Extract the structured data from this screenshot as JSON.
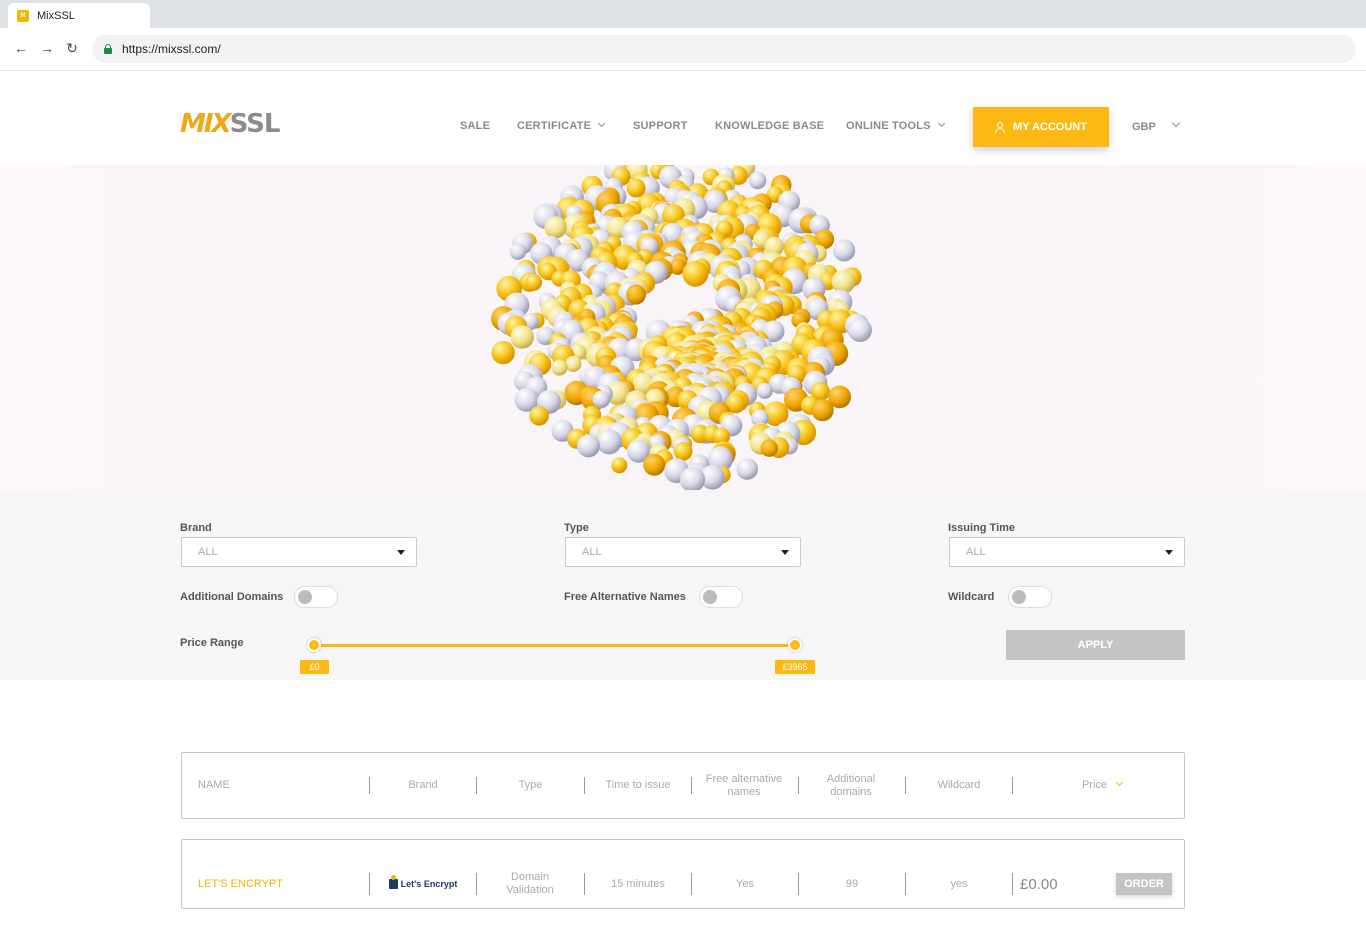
{
  "browser": {
    "tab_title": "MixSSL",
    "favicon_label": "M",
    "url": "https://mixssl.com/",
    "back": "←",
    "forward": "→",
    "reload": "↻"
  },
  "header": {
    "logo_mark": "MIX",
    "logo_text": "SSL",
    "nav": {
      "sale": "SALE",
      "certificate": "CERTIFICATE",
      "support": "SUPPORT",
      "knowledge_base": "KNOWLEDGE BASE",
      "online_tools": "ONLINE TOOLS"
    },
    "account_button": "MY ACCOUNT",
    "currency": "GBP"
  },
  "filters": {
    "brand_label": "Brand",
    "brand_value": "ALL",
    "type_label": "Type",
    "type_value": "ALL",
    "issuing_label": "Issuing Time",
    "issuing_value": "ALL",
    "additional_domains_label": "Additional Domains",
    "free_alt_names_label": "Free Alternative Names",
    "wildcard_label": "Wildcard",
    "price_range_label": "Price Range",
    "price_min": "£0",
    "price_max": "£3965",
    "apply": "APPLY"
  },
  "table": {
    "headers": {
      "name": "NAME",
      "brand": "Brand",
      "type": "Type",
      "time": "Time to issue",
      "free_alt": "Free alternative names",
      "additional": "Additional domains",
      "wildcard": "Wildcard",
      "price": "Price"
    },
    "rows": [
      {
        "name": "LET'S ENCRYPT",
        "brand": "Let's Encrypt",
        "type": "Domain Validation",
        "time": "15 minutes",
        "free_alt": "Yes",
        "additional": "99",
        "wildcard": "yes",
        "price": "£0.00",
        "order": "ORDER"
      }
    ]
  },
  "colors": {
    "accent": "#fdb913",
    "disabled": "#c4c4c4"
  }
}
